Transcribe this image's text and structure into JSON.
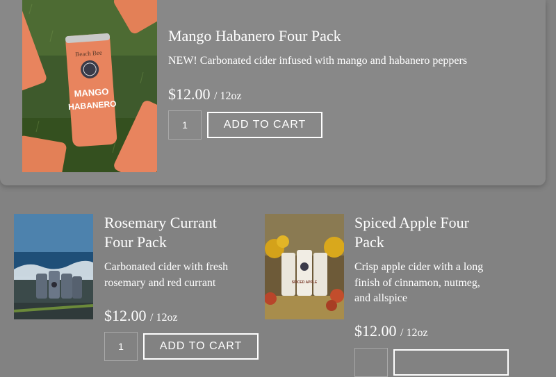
{
  "products": [
    {
      "title": "Mango Habanero Four Pack",
      "description": "NEW! Carbonated cider infused with mango and habanero peppers",
      "price": "$12.00",
      "unit": "/ 12oz",
      "quantity": "1",
      "cart_label": "Add to cart",
      "image": {
        "can_brand": "Beach Bee",
        "can_flavor_line1": "MANGO",
        "can_flavor_line2": "HABANERO",
        "can_color": "#e8845e"
      }
    },
    {
      "title": "Rosemary Currant Four Pack",
      "description": "Carbonated cider with fresh rosemary and red currant",
      "price": "$12.00",
      "unit": "/ 12oz",
      "quantity": "1",
      "cart_label": "Add to cart"
    },
    {
      "title": "Spiced Apple Four Pack",
      "description": "Crisp apple cider with a long finish of cinnamon, nutmeg, and allspice",
      "price": "$12.00",
      "unit": "/ 12oz",
      "quantity": "",
      "cart_label": "",
      "image": {
        "can_flavor": "SPICED APPLE"
      }
    }
  ]
}
